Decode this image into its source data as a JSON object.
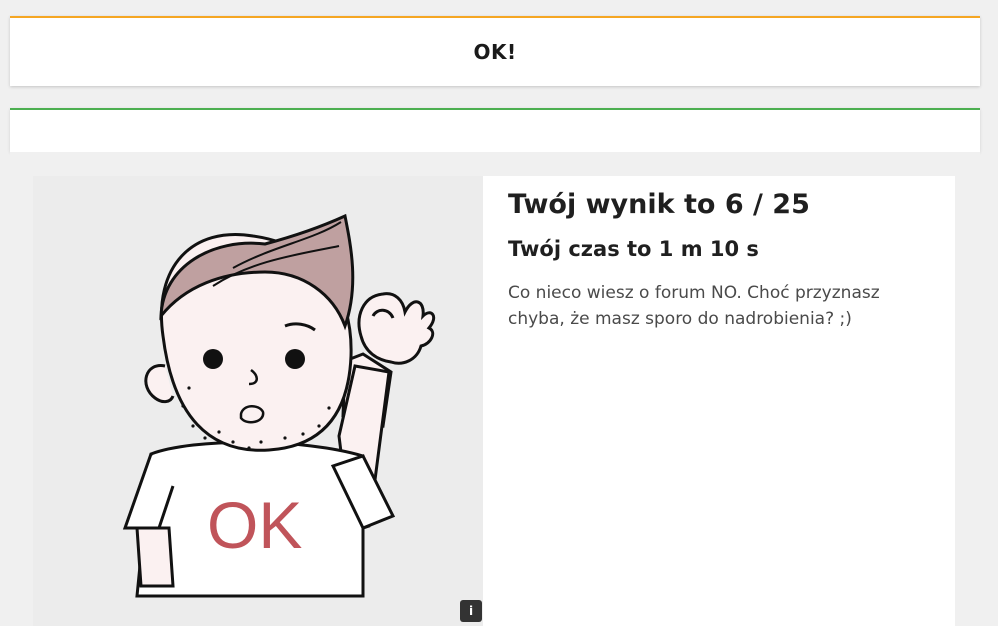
{
  "header": {
    "title": "OK!"
  },
  "result": {
    "score_text": "Twój wynik to 6 / 25",
    "time_text": "Twój czas to 1 m 10 s",
    "description": "Co nieco wiesz o forum NO. Choć przyznasz chyba, że masz sporo do nadrobienia? ;)",
    "image_caption_text": "OK",
    "info_badge_label": "i"
  },
  "colors": {
    "header_accent": "#f5a623",
    "progress_accent": "#4caf50",
    "image_background": "#ececec",
    "hair_color": "#bfa0a0",
    "skin_color": "#fbf1f1",
    "shirt_text_color": "#c0545a"
  }
}
